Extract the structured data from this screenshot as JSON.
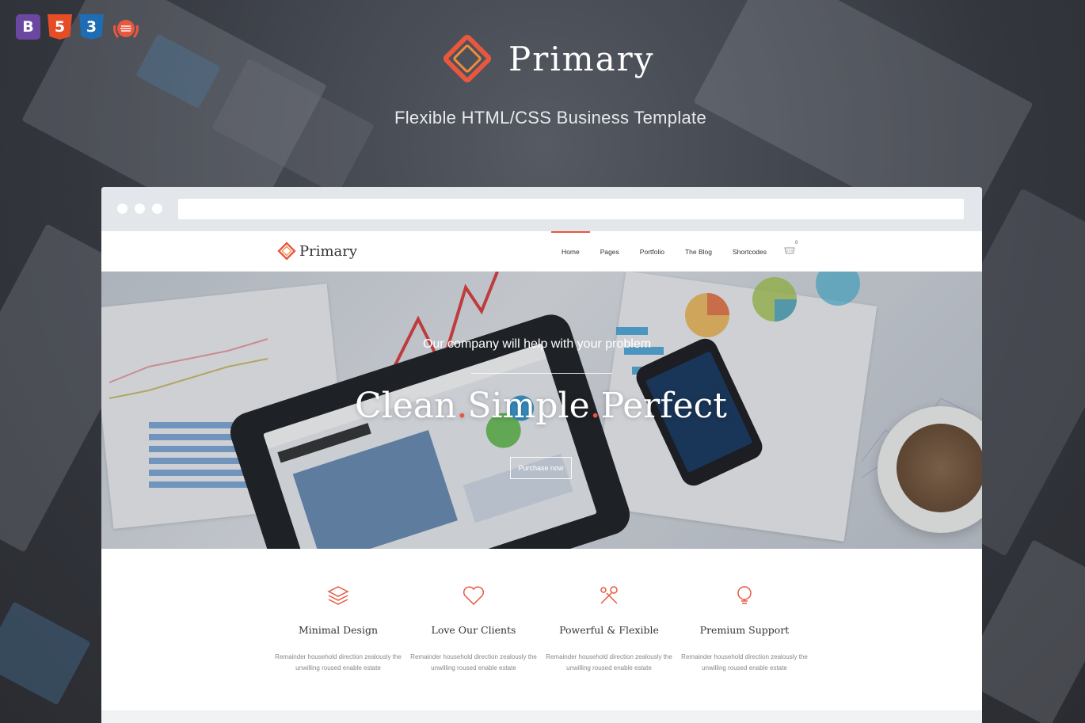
{
  "badges": [
    {
      "name": "bootstrap-icon",
      "label": "B"
    },
    {
      "name": "html5-icon",
      "label": "5"
    },
    {
      "name": "css3-icon",
      "label": "3"
    },
    {
      "name": "award-icon",
      "label": ""
    }
  ],
  "brand": {
    "title": "Primary",
    "tagline": "Flexible HTML/CSS Business Template"
  },
  "colors": {
    "accent": "#e9573f",
    "background": "#3a3d44",
    "chrome": "#e3e6ea"
  },
  "site": {
    "logo_text": "Primary",
    "menu": [
      {
        "label": "Home",
        "active": true
      },
      {
        "label": "Pages",
        "active": false
      },
      {
        "label": "Portfolio",
        "active": false
      },
      {
        "label": "The Blog",
        "active": false
      },
      {
        "label": "Shortcodes",
        "active": false
      }
    ],
    "cart_count": "0"
  },
  "hero": {
    "subtitle": "Our company will help with your problem",
    "title_words": [
      "Clean",
      "Simple",
      "Perfect"
    ],
    "separator": ".",
    "button_label": "Purchase now"
  },
  "features": [
    {
      "icon": "layers-icon",
      "title": "Minimal Design",
      "text": "Remainder household direction zealously the unwilling roused enable estate"
    },
    {
      "icon": "heart-icon",
      "title": "Love Our Clients",
      "text": "Remainder household direction zealously the unwilling roused enable estate"
    },
    {
      "icon": "tools-icon",
      "title": "Powerful & Flexible",
      "text": "Remainder household direction zealously the unwilling roused enable estate"
    },
    {
      "icon": "lightbulb-icon",
      "title": "Premium Support",
      "text": "Remainder household direction zealously the unwilling roused enable estate"
    }
  ]
}
